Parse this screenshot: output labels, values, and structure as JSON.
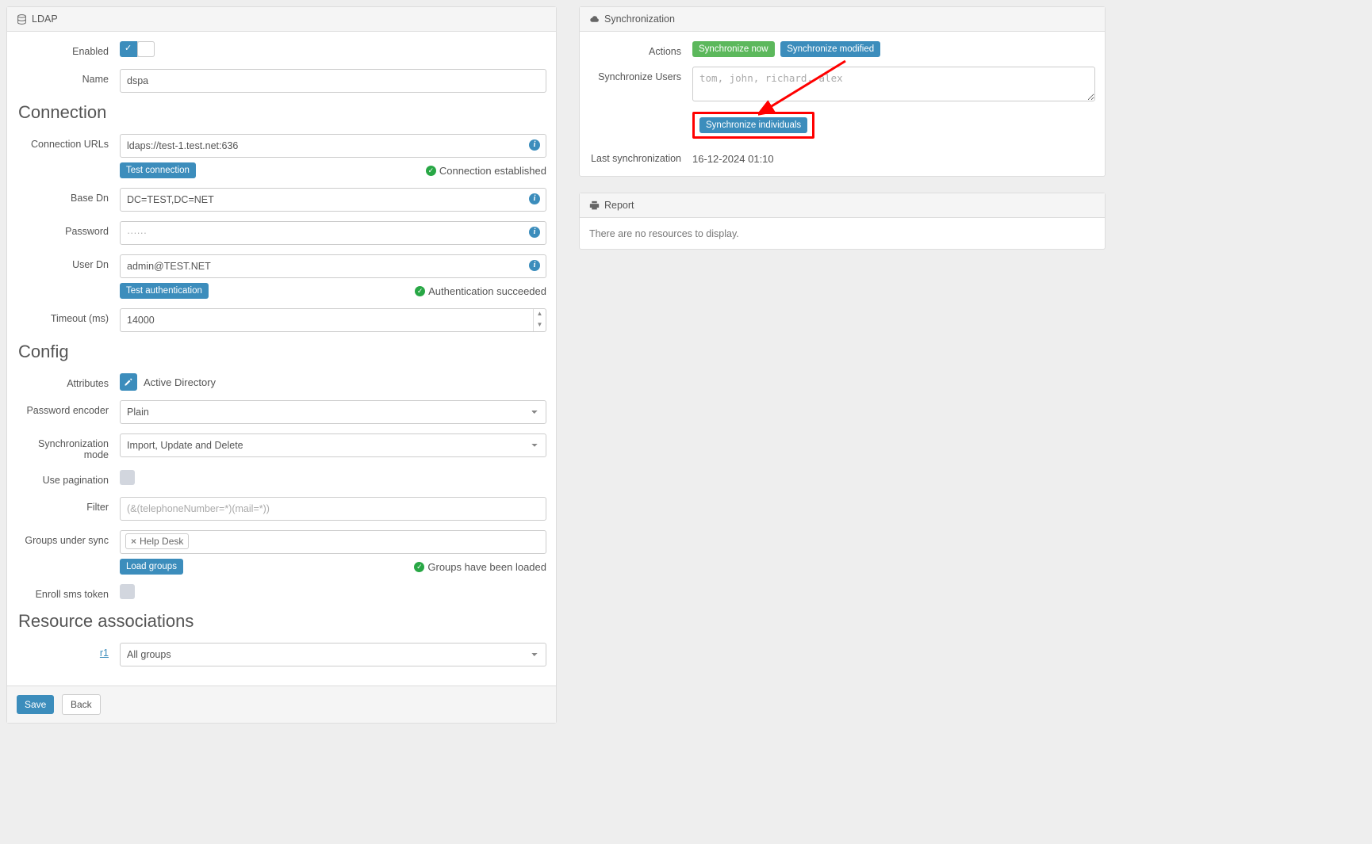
{
  "panels": {
    "ldap": {
      "title": "LDAP"
    },
    "sync": {
      "title": "Synchronization"
    },
    "report": {
      "title": "Report",
      "empty_text": "There are no resources to display."
    }
  },
  "ldap": {
    "enabled_label": "Enabled",
    "name_label": "Name",
    "name_value": "dspa",
    "sections": {
      "connection": "Connection",
      "config": "Config",
      "resource_assoc": "Resource associations"
    },
    "connection": {
      "urls_label": "Connection URLs",
      "urls_value": "ldaps://test-1.test.net:636",
      "test_conn_btn": "Test connection",
      "test_conn_status": "Connection established",
      "base_dn_label": "Base Dn",
      "base_dn_value": "DC=TEST,DC=NET",
      "password_label": "Password",
      "password_placeholder": "······",
      "user_dn_label": "User Dn",
      "user_dn_value": "admin@TEST.NET",
      "test_auth_btn": "Test authentication",
      "test_auth_status": "Authentication succeeded",
      "timeout_label": "Timeout (ms)",
      "timeout_value": "14000"
    },
    "config": {
      "attributes_label": "Attributes",
      "attributes_value": "Active Directory",
      "pwd_encoder_label": "Password encoder",
      "pwd_encoder_value": "Plain",
      "sync_mode_label": "Synchronization mode",
      "sync_mode_value": "Import, Update and Delete",
      "use_pagination_label": "Use pagination",
      "filter_label": "Filter",
      "filter_placeholder": "(&(telephoneNumber=*)(mail=*))",
      "groups_label": "Groups under sync",
      "groups_tag": "Help Desk",
      "load_groups_btn": "Load groups",
      "load_groups_status": "Groups have been loaded",
      "enroll_sms_label": "Enroll sms token"
    },
    "resource_assoc": {
      "r1_label": "r1",
      "r1_value": "All groups"
    },
    "footer": {
      "save": "Save",
      "back": "Back"
    }
  },
  "sync": {
    "actions_label": "Actions",
    "sync_now_btn": "Synchronize now",
    "sync_modified_btn": "Synchronize modified",
    "sync_users_label": "Synchronize Users",
    "sync_users_placeholder": "tom, john, richard, alex",
    "sync_individuals_btn": "Synchronize individuals",
    "last_sync_label": "Last synchronization",
    "last_sync_value": "16-12-2024 01:10"
  }
}
